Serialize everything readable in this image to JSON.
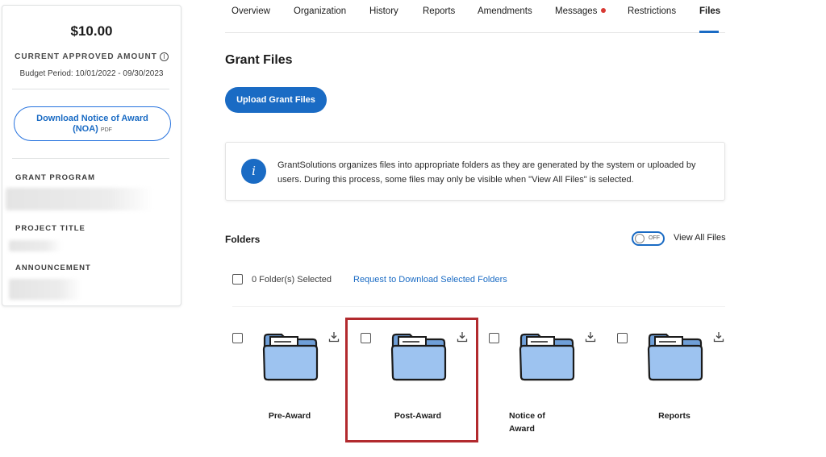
{
  "summary": {
    "amount": "$10.00",
    "amount_label": "CURRENT APPROVED AMOUNT",
    "budget_period": "Budget Period: 10/01/2022 - 09/30/2023",
    "noa_button_line1": "Download Notice of Award",
    "noa_button_line2": "(NOA)",
    "noa_button_suffix": "PDF",
    "grant_program_label": "GRANT PROGRAM",
    "project_title_label": "PROJECT TITLE",
    "announcement_label": "ANNOUNCEMENT"
  },
  "tabs": [
    {
      "label": "Overview"
    },
    {
      "label": "Organization"
    },
    {
      "label": "History"
    },
    {
      "label": "Reports"
    },
    {
      "label": "Amendments"
    },
    {
      "label": "Messages"
    },
    {
      "label": "Restrictions"
    },
    {
      "label": "Files"
    }
  ],
  "main": {
    "title": "Grant Files",
    "upload_button": "Upload Grant Files",
    "info_text": "GrantSolutions organizes files into appropriate folders as they are generated by the system or uploaded by users. During this process, some files may only be visible when \"View All Files\" is selected.",
    "folders_title": "Folders",
    "toggle_state": "OFF",
    "view_all_label": "View All Files",
    "selected_count": "0 Folder(s) Selected",
    "request_link": "Request to Download Selected Folders"
  },
  "folders": [
    {
      "name": "Pre-Award"
    },
    {
      "name": "Post-Award"
    },
    {
      "name": "Notice of Award"
    },
    {
      "name": "Reports"
    }
  ],
  "colors": {
    "accent": "#1a6bc4",
    "notification_dot": "#d83933",
    "highlight_border": "#b22a2e",
    "folder_fill": "#9dc3f0"
  }
}
